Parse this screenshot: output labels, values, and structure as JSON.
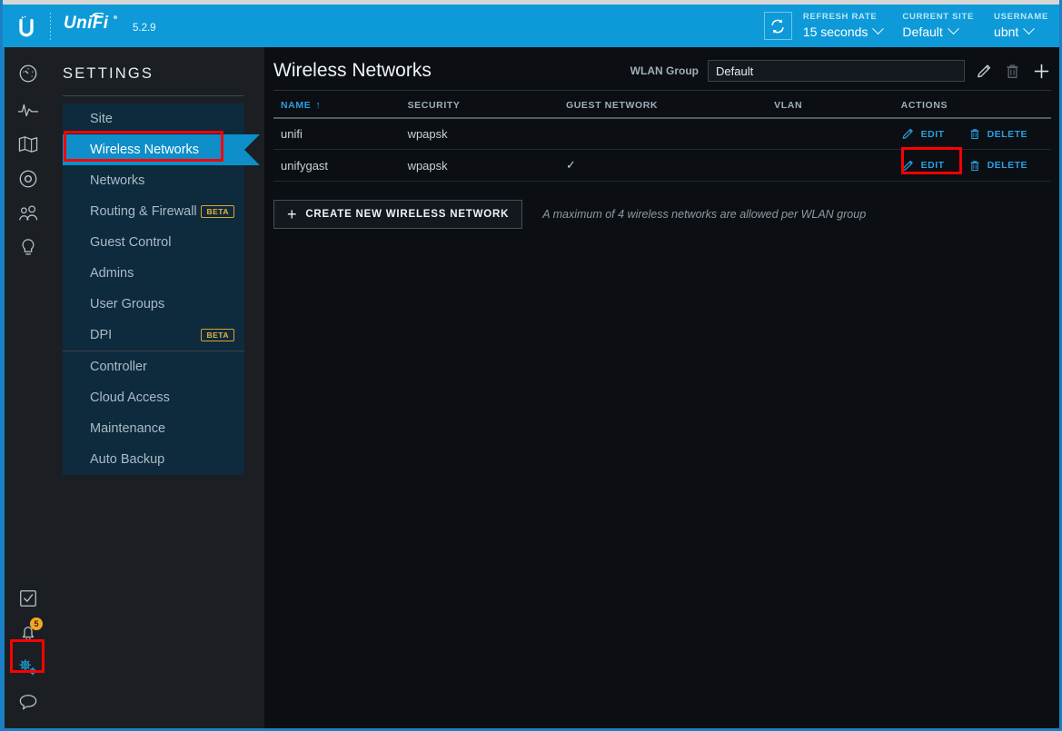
{
  "header": {
    "brand": "UniFi",
    "brand_tm": "®",
    "version": "5.2.9",
    "refresh_icon": "refresh-icon",
    "refresh": {
      "label": "REFRESH RATE",
      "value": "15 seconds"
    },
    "site": {
      "label": "CURRENT SITE",
      "value": "Default"
    },
    "user": {
      "label": "USERNAME",
      "value": "ubnt"
    }
  },
  "rail": {
    "top_items": [
      {
        "name": "dashboard-icon",
        "title": "Dashboard"
      },
      {
        "name": "statistics-icon",
        "title": "Statistics"
      },
      {
        "name": "map-icon",
        "title": "Map"
      },
      {
        "name": "devices-icon",
        "title": "Devices"
      },
      {
        "name": "clients-icon",
        "title": "Clients"
      },
      {
        "name": "insights-icon",
        "title": "Insights"
      }
    ],
    "bottom_items": [
      {
        "name": "tasks-icon",
        "title": "Tasks",
        "badge": ""
      },
      {
        "name": "alerts-bell-icon",
        "title": "Alerts",
        "badge": "5"
      },
      {
        "name": "settings-gears-icon",
        "title": "Settings",
        "badge": "",
        "active": true
      },
      {
        "name": "chat-icon",
        "title": "Chat",
        "badge": ""
      }
    ]
  },
  "sidebar": {
    "title": "SETTINGS",
    "items": [
      {
        "label": "Site",
        "badge": "",
        "active": false
      },
      {
        "label": "Wireless Networks",
        "badge": "",
        "active": true
      },
      {
        "label": "Networks",
        "badge": "",
        "active": false
      },
      {
        "label": "Routing & Firewall",
        "badge": "BETA",
        "active": false
      },
      {
        "label": "Guest Control",
        "badge": "",
        "active": false
      },
      {
        "label": "Admins",
        "badge": "",
        "active": false
      },
      {
        "label": "User Groups",
        "badge": "",
        "active": false
      },
      {
        "label": "DPI",
        "badge": "BETA",
        "active": false
      },
      {
        "label": "Controller",
        "badge": "",
        "active": false,
        "divider_before": true
      },
      {
        "label": "Cloud Access",
        "badge": "",
        "active": false
      },
      {
        "label": "Maintenance",
        "badge": "",
        "active": false
      },
      {
        "label": "Auto Backup",
        "badge": "",
        "active": false
      }
    ]
  },
  "main": {
    "page_title": "Wireless Networks",
    "wlan_group": {
      "label": "WLAN Group",
      "value": "Default",
      "placeholder": "Default",
      "edit_icon": "pencil-icon",
      "delete_icon": "trash-icon",
      "add_icon": "plus-icon"
    },
    "table": {
      "columns": [
        {
          "label": "NAME",
          "sorted": true,
          "sort_arrow": "↑"
        },
        {
          "label": "SECURITY",
          "sorted": false,
          "sort_arrow": ""
        },
        {
          "label": "GUEST NETWORK",
          "sorted": false,
          "sort_arrow": ""
        },
        {
          "label": "VLAN",
          "sorted": false,
          "sort_arrow": ""
        },
        {
          "label": "ACTIONS",
          "sorted": false,
          "sort_arrow": ""
        }
      ],
      "rows": [
        {
          "name": "unifi",
          "security": "wpapsk",
          "guest_network": "",
          "vlan": "",
          "edit_label": "EDIT",
          "delete_label": "DELETE",
          "edit_highlighted": false
        },
        {
          "name": "unifygast",
          "security": "wpapsk",
          "guest_network": "✓",
          "vlan": "",
          "edit_label": "EDIT",
          "delete_label": "DELETE",
          "edit_highlighted": true
        }
      ]
    },
    "create_button": {
      "plus": "+",
      "label": "CREATE NEW WIRELESS NETWORK"
    },
    "hint": "A maximum of 4 wireless networks are allowed per WLAN group"
  },
  "colors": {
    "brand_blue": "#0e9ad8",
    "accent_blue": "#2b9fe0",
    "active_nav": "#0e8fc9",
    "nav_panel": "#0e2a3d",
    "highlight_red": "#fe0000",
    "badge_orange": "#f5a623",
    "beta_gold": "#e8b33c"
  }
}
